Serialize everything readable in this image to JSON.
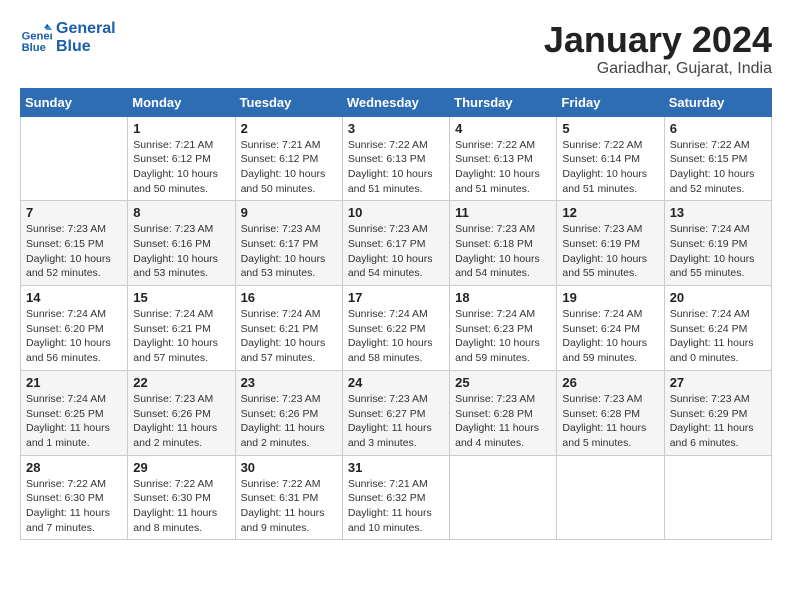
{
  "header": {
    "logo_line1": "General",
    "logo_line2": "Blue",
    "month": "January 2024",
    "location": "Gariadhar, Gujarat, India"
  },
  "weekdays": [
    "Sunday",
    "Monday",
    "Tuesday",
    "Wednesday",
    "Thursday",
    "Friday",
    "Saturday"
  ],
  "weeks": [
    [
      {
        "day": "",
        "text": ""
      },
      {
        "day": "1",
        "text": "Sunrise: 7:21 AM\nSunset: 6:12 PM\nDaylight: 10 hours\nand 50 minutes."
      },
      {
        "day": "2",
        "text": "Sunrise: 7:21 AM\nSunset: 6:12 PM\nDaylight: 10 hours\nand 50 minutes."
      },
      {
        "day": "3",
        "text": "Sunrise: 7:22 AM\nSunset: 6:13 PM\nDaylight: 10 hours\nand 51 minutes."
      },
      {
        "day": "4",
        "text": "Sunrise: 7:22 AM\nSunset: 6:13 PM\nDaylight: 10 hours\nand 51 minutes."
      },
      {
        "day": "5",
        "text": "Sunrise: 7:22 AM\nSunset: 6:14 PM\nDaylight: 10 hours\nand 51 minutes."
      },
      {
        "day": "6",
        "text": "Sunrise: 7:22 AM\nSunset: 6:15 PM\nDaylight: 10 hours\nand 52 minutes."
      }
    ],
    [
      {
        "day": "7",
        "text": "Sunrise: 7:23 AM\nSunset: 6:15 PM\nDaylight: 10 hours\nand 52 minutes."
      },
      {
        "day": "8",
        "text": "Sunrise: 7:23 AM\nSunset: 6:16 PM\nDaylight: 10 hours\nand 53 minutes."
      },
      {
        "day": "9",
        "text": "Sunrise: 7:23 AM\nSunset: 6:17 PM\nDaylight: 10 hours\nand 53 minutes."
      },
      {
        "day": "10",
        "text": "Sunrise: 7:23 AM\nSunset: 6:17 PM\nDaylight: 10 hours\nand 54 minutes."
      },
      {
        "day": "11",
        "text": "Sunrise: 7:23 AM\nSunset: 6:18 PM\nDaylight: 10 hours\nand 54 minutes."
      },
      {
        "day": "12",
        "text": "Sunrise: 7:23 AM\nSunset: 6:19 PM\nDaylight: 10 hours\nand 55 minutes."
      },
      {
        "day": "13",
        "text": "Sunrise: 7:24 AM\nSunset: 6:19 PM\nDaylight: 10 hours\nand 55 minutes."
      }
    ],
    [
      {
        "day": "14",
        "text": "Sunrise: 7:24 AM\nSunset: 6:20 PM\nDaylight: 10 hours\nand 56 minutes."
      },
      {
        "day": "15",
        "text": "Sunrise: 7:24 AM\nSunset: 6:21 PM\nDaylight: 10 hours\nand 57 minutes."
      },
      {
        "day": "16",
        "text": "Sunrise: 7:24 AM\nSunset: 6:21 PM\nDaylight: 10 hours\nand 57 minutes."
      },
      {
        "day": "17",
        "text": "Sunrise: 7:24 AM\nSunset: 6:22 PM\nDaylight: 10 hours\nand 58 minutes."
      },
      {
        "day": "18",
        "text": "Sunrise: 7:24 AM\nSunset: 6:23 PM\nDaylight: 10 hours\nand 59 minutes."
      },
      {
        "day": "19",
        "text": "Sunrise: 7:24 AM\nSunset: 6:24 PM\nDaylight: 10 hours\nand 59 minutes."
      },
      {
        "day": "20",
        "text": "Sunrise: 7:24 AM\nSunset: 6:24 PM\nDaylight: 11 hours\nand 0 minutes."
      }
    ],
    [
      {
        "day": "21",
        "text": "Sunrise: 7:24 AM\nSunset: 6:25 PM\nDaylight: 11 hours\nand 1 minute."
      },
      {
        "day": "22",
        "text": "Sunrise: 7:23 AM\nSunset: 6:26 PM\nDaylight: 11 hours\nand 2 minutes."
      },
      {
        "day": "23",
        "text": "Sunrise: 7:23 AM\nSunset: 6:26 PM\nDaylight: 11 hours\nand 2 minutes."
      },
      {
        "day": "24",
        "text": "Sunrise: 7:23 AM\nSunset: 6:27 PM\nDaylight: 11 hours\nand 3 minutes."
      },
      {
        "day": "25",
        "text": "Sunrise: 7:23 AM\nSunset: 6:28 PM\nDaylight: 11 hours\nand 4 minutes."
      },
      {
        "day": "26",
        "text": "Sunrise: 7:23 AM\nSunset: 6:28 PM\nDaylight: 11 hours\nand 5 minutes."
      },
      {
        "day": "27",
        "text": "Sunrise: 7:23 AM\nSunset: 6:29 PM\nDaylight: 11 hours\nand 6 minutes."
      }
    ],
    [
      {
        "day": "28",
        "text": "Sunrise: 7:22 AM\nSunset: 6:30 PM\nDaylight: 11 hours\nand 7 minutes."
      },
      {
        "day": "29",
        "text": "Sunrise: 7:22 AM\nSunset: 6:30 PM\nDaylight: 11 hours\nand 8 minutes."
      },
      {
        "day": "30",
        "text": "Sunrise: 7:22 AM\nSunset: 6:31 PM\nDaylight: 11 hours\nand 9 minutes."
      },
      {
        "day": "31",
        "text": "Sunrise: 7:21 AM\nSunset: 6:32 PM\nDaylight: 11 hours\nand 10 minutes."
      },
      {
        "day": "",
        "text": ""
      },
      {
        "day": "",
        "text": ""
      },
      {
        "day": "",
        "text": ""
      }
    ]
  ]
}
